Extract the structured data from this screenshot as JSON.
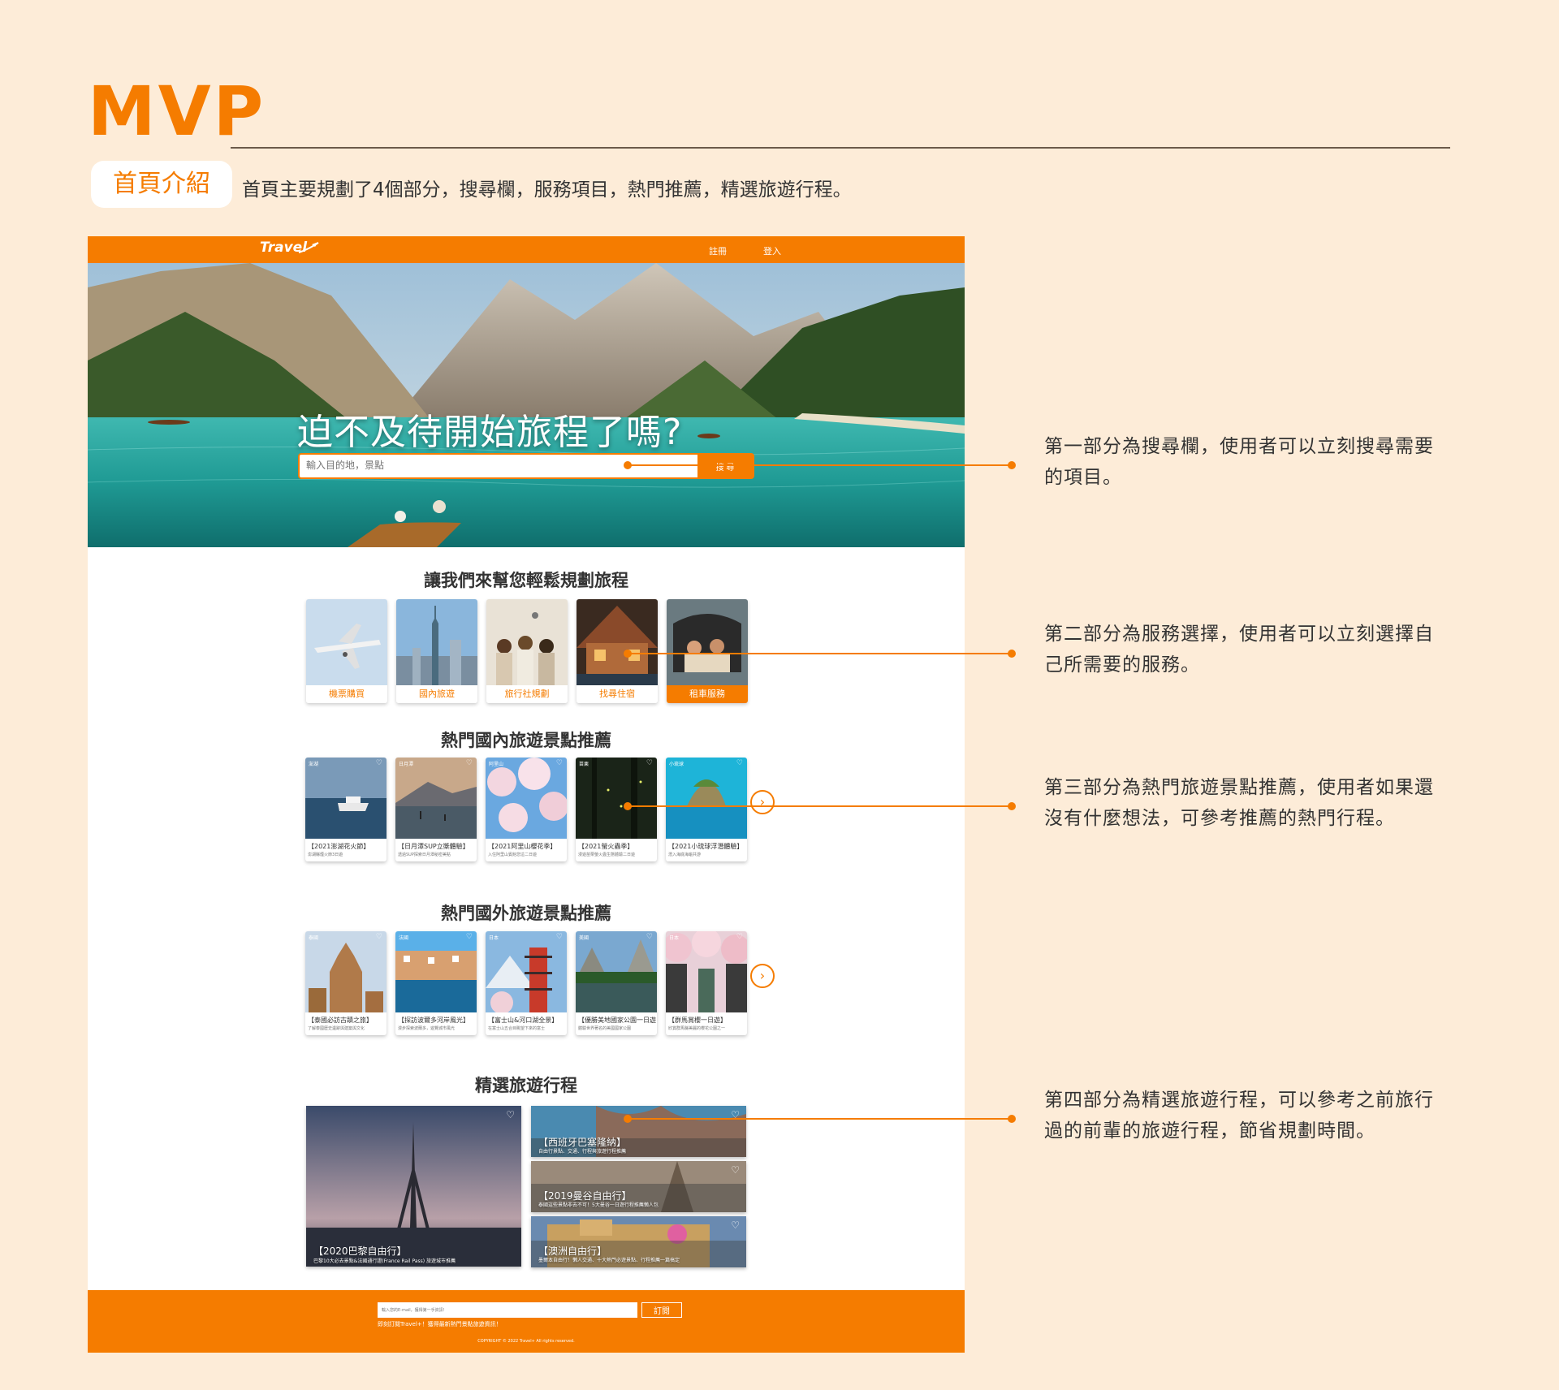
{
  "slide": {
    "title": "MVP",
    "section_pill": "首頁介紹",
    "intro": "首頁主要規劃了4個部分，搜尋欄，服務項目，熱門推薦，精選旅遊行程。"
  },
  "site": {
    "logo": "Travel",
    "nav": {
      "register": "註冊",
      "login": "登入"
    },
    "hero": {
      "title": "迫不及待開始旅程了嗎?",
      "search_placeholder": "輸入目的地，景點",
      "search_button": "搜 尋"
    },
    "services": {
      "title": "讓我們來幫您輕鬆規劃旅程",
      "items": [
        {
          "label": "機票購買"
        },
        {
          "label": "國內旅遊"
        },
        {
          "label": "旅行社規劃"
        },
        {
          "label": "找尋住宿"
        },
        {
          "label": "租車服務"
        }
      ]
    },
    "domestic": {
      "title": "熱門國內旅遊景點推薦",
      "cards": [
        {
          "location": "澎湖",
          "title": "【2021澎湖花火節】",
          "desc": "澎湖縣煙火節3日遊"
        },
        {
          "location": "日月潭",
          "title": "【日月潭SUP立槳體驗】",
          "desc": "透過SUP探索日月潭秘密美點"
        },
        {
          "location": "阿里山",
          "title": "【2021阿里山櫻花季】",
          "desc": "入住阿里山賓館您這二日遊"
        },
        {
          "location": "苗栗",
          "title": "【2021螢火蟲季】",
          "desc": "漫遊苗栗螢火蟲生態體驗二日遊"
        },
        {
          "location": "小琉球",
          "title": "【2021小琉球浮潛體驗】",
          "desc": "潛入海底海龜共游"
        }
      ]
    },
    "overseas": {
      "title": "熱門國外旅遊景點推薦",
      "cards": [
        {
          "location": "泰國",
          "title": "【泰國必訪古蹟之旅】",
          "desc": "了解泰國歷史遺跡與建築與文化"
        },
        {
          "location": "法國",
          "title": "【探訪波爾多河岸風光】",
          "desc": "漫步探索波爾多，遊覽城市風光"
        },
        {
          "location": "日本",
          "title": "【富士山&河口湖全景】",
          "desc": "在富士山五合目眺望下來的富士"
        },
        {
          "location": "美國",
          "title": "【優勝美地國家公園一日遊】",
          "desc": "體驗世界著名的美國國家公園"
        },
        {
          "location": "日本",
          "title": "【群馬賞櫻一日遊】",
          "desc": "欣賞群馬縣美麗的櫻花公園之一"
        }
      ]
    },
    "itineraries": {
      "title": "精選旅遊行程",
      "items": [
        {
          "title": "【2020巴黎自由行】",
          "desc": "巴黎10大必去景點&法國通行證(France Rail Pass) 旅遊城市推薦"
        },
        {
          "title": "【西班牙巴塞隆納】",
          "desc": "自由行景點、交通、行程與旅遊行程推薦"
        },
        {
          "title": "【2019曼谷自由行】",
          "desc": "泰國這些景點非去不可！5大曼谷一日遊行程推薦懶人包"
        },
        {
          "title": "【澳洲自由行】",
          "desc": "墨爾本自由行！懶人交通、十大熱門必遊景點、行程推薦一篇搞定"
        }
      ]
    },
    "footer": {
      "subscribe_placeholder": "輸入您的E-mail，獲得第一手資訊!",
      "subscribe_button": "訂閱",
      "subscribe_note": "即刻訂閱Travel+！獲得最新熱門景點旅遊資訊！",
      "copyright": "COPYRIGHT © 2022 Travel+ All rights reserved."
    }
  },
  "annotations": [
    "第一部分為搜尋欄，使用者可以立刻搜尋需要的項目。",
    "第二部分為服務選擇，使用者可以立刻選擇自己所需要的服務。",
    "第三部分為熱門旅遊景點推薦，使用者如果還沒有什麼想法，可參考推薦的熱門行程。",
    "第四部分為精選旅遊行程，可以參考之前旅行過的前輩的旅遊行程，節省規劃時間。"
  ],
  "colors": {
    "accent": "#f57c00",
    "background": "#fdecd8"
  }
}
